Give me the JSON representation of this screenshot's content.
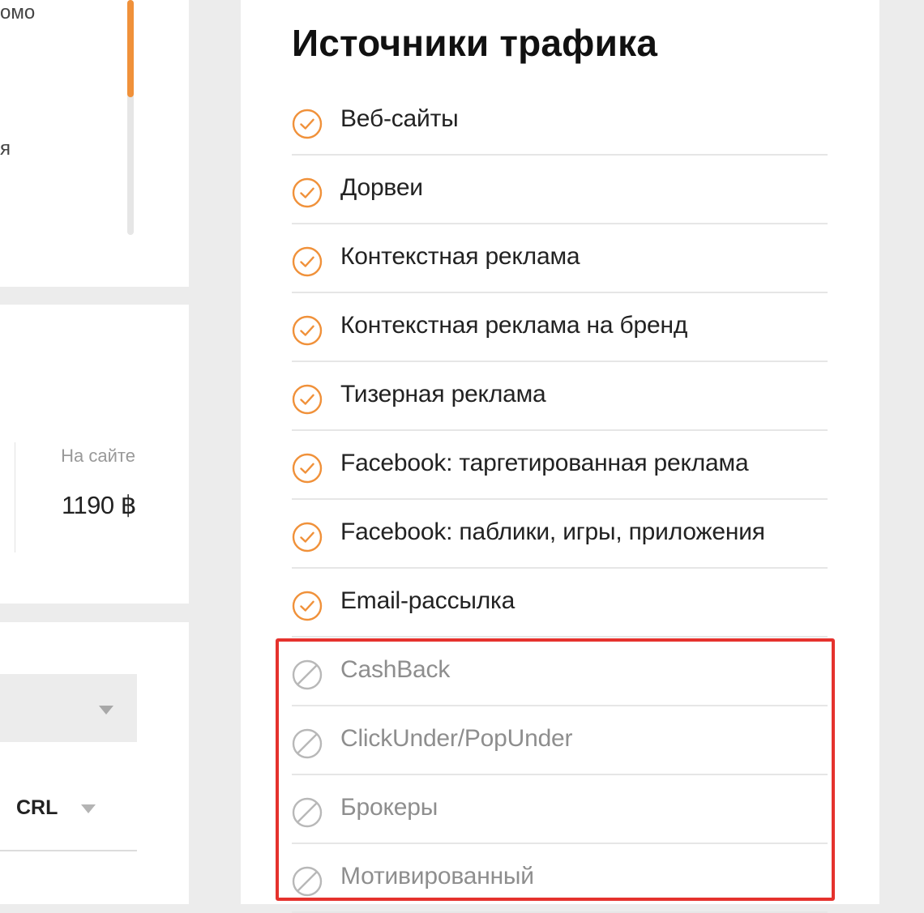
{
  "left_column": {
    "promo_fragment": "омо",
    "ya_fragment": "я",
    "on_site_label": "На сайте",
    "on_site_price": "1190 ฿",
    "currency_dropdown": "CRL"
  },
  "traffic_sources": {
    "title": "Источники трафика",
    "items": [
      {
        "label": "Веб-сайты",
        "status": "allowed",
        "icon": "check-circle-icon"
      },
      {
        "label": "Дорвеи",
        "status": "allowed",
        "icon": "check-circle-icon"
      },
      {
        "label": "Контекстная реклама",
        "status": "allowed",
        "icon": "check-circle-icon"
      },
      {
        "label": "Контекстная реклама на бренд",
        "status": "allowed",
        "icon": "check-circle-icon"
      },
      {
        "label": "Тизерная реклама",
        "status": "allowed",
        "icon": "check-circle-icon"
      },
      {
        "label": "Facebook: таргетированная реклама",
        "status": "allowed",
        "icon": "check-circle-icon"
      },
      {
        "label": "Facebook: паблики, игры, приложения",
        "status": "allowed",
        "icon": "check-circle-icon"
      },
      {
        "label": "Email-рассылка",
        "status": "allowed",
        "icon": "check-circle-icon"
      },
      {
        "label": "CashBack",
        "status": "forbidden",
        "icon": "forbidden-circle-icon"
      },
      {
        "label": "ClickUnder/PopUnder",
        "status": "forbidden",
        "icon": "forbidden-circle-icon"
      },
      {
        "label": "Брокеры",
        "status": "forbidden",
        "icon": "forbidden-circle-icon"
      },
      {
        "label": "Мотивированный",
        "status": "forbidden",
        "icon": "forbidden-circle-icon"
      }
    ]
  },
  "colors": {
    "accent_orange": "#f0913a",
    "forbidden_gray": "#b8b8b8",
    "highlight_red": "#e5322d",
    "page_background": "#ececec"
  }
}
